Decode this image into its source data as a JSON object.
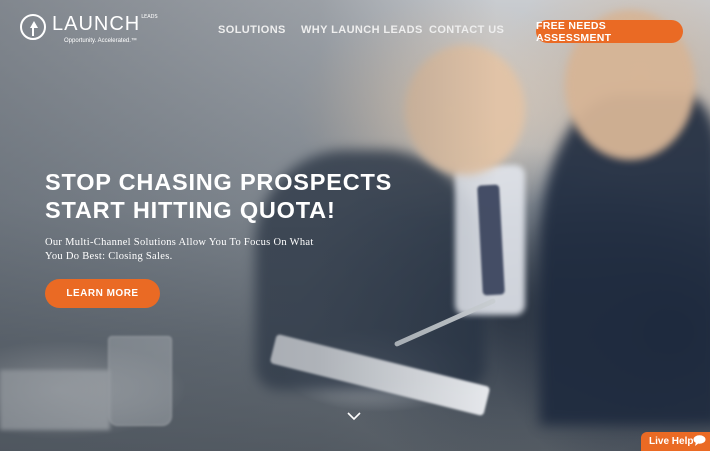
{
  "logo": {
    "name": "LAUNCH",
    "tm": "LEADS",
    "tagline": "Opportunity. Accelerated.™"
  },
  "nav": {
    "solutions": "SOLUTIONS",
    "why": "WHY LAUNCH LEADS",
    "contact": "CONTACT US",
    "cta": "FREE NEEDS ASSESSMENT"
  },
  "hero": {
    "headline_line1": "STOP CHASING PROSPECTS",
    "headline_line2": "START HITTING QUOTA!",
    "subline_line1": "Our Multi-Channel Solutions Allow You To Focus On What",
    "subline_line2": "You Do Best: Closing Sales.",
    "cta": "LEARN MORE"
  },
  "live_help": {
    "label": "Live Help"
  },
  "colors": {
    "accent": "#ea6a24",
    "text_light": "#ffffff"
  },
  "icons": {
    "logo": "launch-logo-icon",
    "scroll": "chevron-down-icon",
    "chat": "chat-bubble-icon"
  }
}
